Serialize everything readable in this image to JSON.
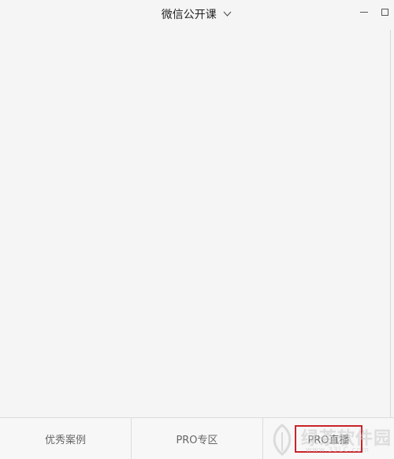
{
  "window": {
    "title": "微信公开课"
  },
  "tabs": [
    {
      "label": "优秀案例"
    },
    {
      "label": "PRO专区"
    },
    {
      "label": "PRO直播"
    }
  ],
  "watermark": {
    "text": "绿茶软件园",
    "url": "www.33LC.com"
  },
  "colors": {
    "background": "#f5f5f5",
    "highlight_box": "#c8242b",
    "tab_text": "#666666"
  }
}
